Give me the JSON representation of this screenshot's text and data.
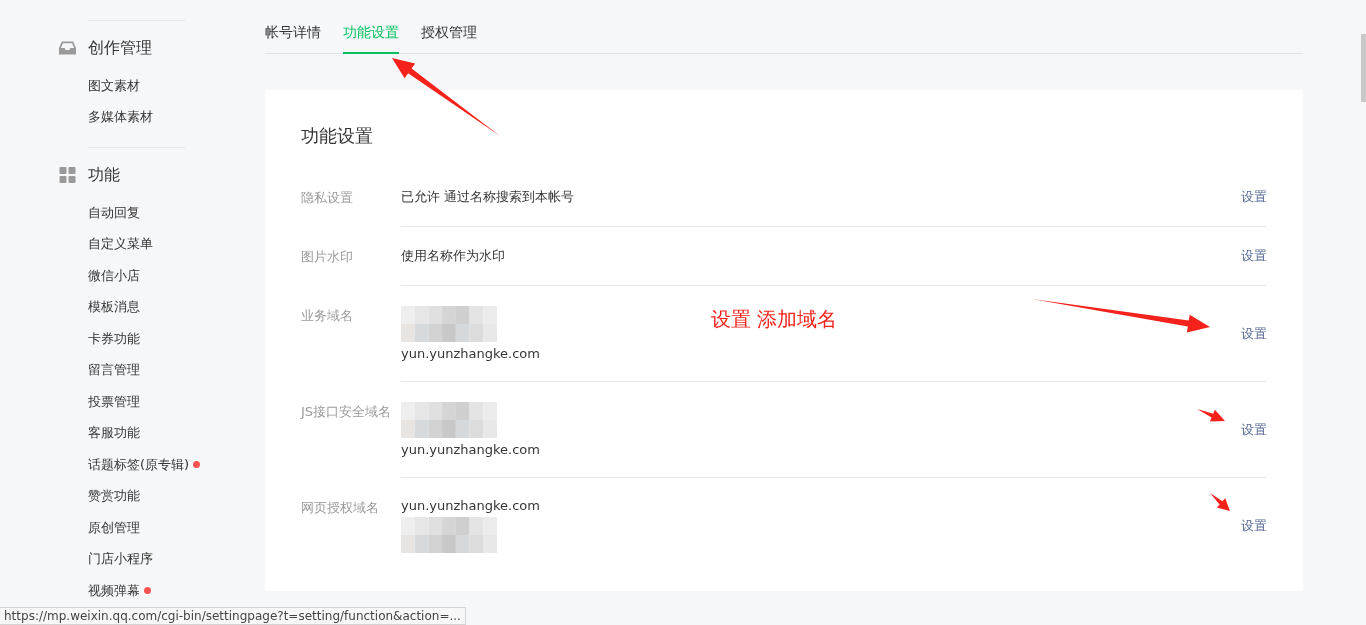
{
  "sidebar": {
    "sections": [
      {
        "title": "创作管理",
        "items": [
          {
            "label": "图文素材",
            "dot": false
          },
          {
            "label": "多媒体素材",
            "dot": false
          }
        ]
      },
      {
        "title": "功能",
        "items": [
          {
            "label": "自动回复",
            "dot": false
          },
          {
            "label": "自定义菜单",
            "dot": false
          },
          {
            "label": "微信小店",
            "dot": false
          },
          {
            "label": "模板消息",
            "dot": false
          },
          {
            "label": "卡券功能",
            "dot": false
          },
          {
            "label": "留言管理",
            "dot": false
          },
          {
            "label": "投票管理",
            "dot": false
          },
          {
            "label": "客服功能",
            "dot": false
          },
          {
            "label": "话题标签(原专辑)",
            "dot": true
          },
          {
            "label": "赞赏功能",
            "dot": false
          },
          {
            "label": "原创管理",
            "dot": false
          },
          {
            "label": "门店小程序",
            "dot": false
          },
          {
            "label": "视频弹幕",
            "dot": true
          }
        ]
      }
    ]
  },
  "tabs": [
    {
      "label": "帐号详情",
      "selected": false
    },
    {
      "label": "功能设置",
      "selected": true
    },
    {
      "label": "授权管理",
      "selected": false
    }
  ],
  "card": {
    "title": "功能设置",
    "rows": [
      {
        "label": "隐私设置",
        "lines": [
          {
            "kind": "text",
            "text": "已允许 通过名称搜索到本帐号"
          }
        ],
        "action": "设置"
      },
      {
        "label": "图片水印",
        "lines": [
          {
            "kind": "text",
            "text": "使用名称作为水印"
          }
        ],
        "action": "设置"
      },
      {
        "label": "业务域名",
        "lines": [
          {
            "kind": "redacted"
          },
          {
            "kind": "text",
            "text": "yun.yunzhangke.com"
          }
        ],
        "action": "设置"
      },
      {
        "label": "JS接口安全域名",
        "lines": [
          {
            "kind": "redacted"
          },
          {
            "kind": "text",
            "text": "yun.yunzhangke.com"
          }
        ],
        "action": "设置"
      },
      {
        "label": "网页授权域名",
        "lines": [
          {
            "kind": "text",
            "text": "yun.yunzhangke.com"
          },
          {
            "kind": "redacted"
          }
        ],
        "action": "设置"
      }
    ]
  },
  "annotation": {
    "text": "设置 添加域名"
  },
  "status_bar": {
    "url": "https://mp.weixin.qq.com/cgi-bin/settingpage?t=setting/function&action=..."
  }
}
